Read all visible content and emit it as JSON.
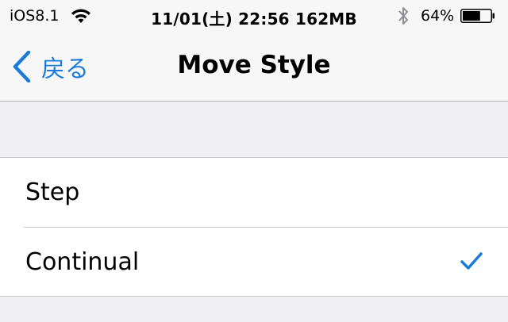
{
  "status_bar": {
    "carrier": "iOS8.1",
    "center_text": "11/01(土) 22:56 162MB",
    "battery_percent_label": "64%",
    "battery_level": 0.64,
    "icons": [
      "wifi-icon",
      "bluetooth-icon",
      "battery-icon"
    ]
  },
  "nav": {
    "back_label": "戻る",
    "title": "Move Style"
  },
  "list": {
    "items": [
      {
        "label": "Step",
        "selected": false
      },
      {
        "label": "Continual",
        "selected": true
      }
    ]
  },
  "colors": {
    "accent": "#1a7bdb",
    "background": "#efeff4",
    "separator": "#c8c7cc"
  }
}
